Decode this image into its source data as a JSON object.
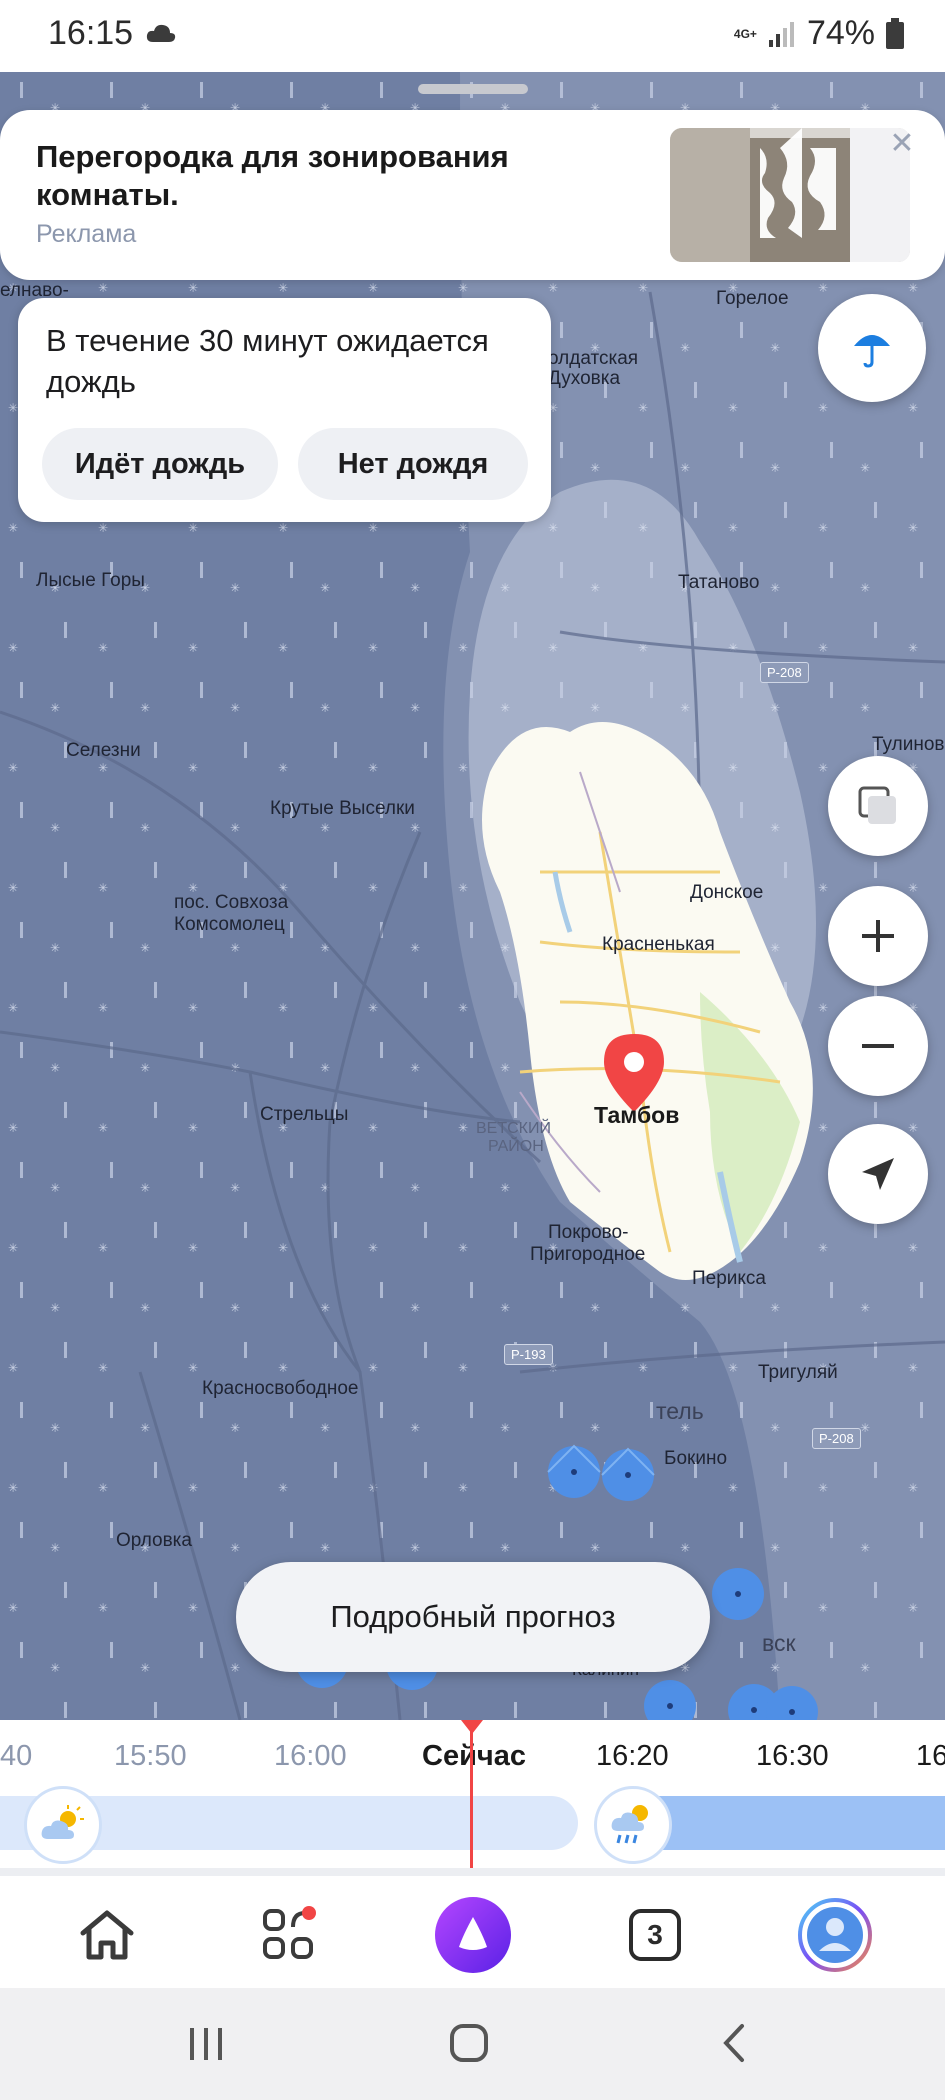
{
  "status_bar": {
    "time": "16:15",
    "weather_icon": "cloud-icon",
    "network": "4G+",
    "battery": "74%"
  },
  "ad": {
    "title": "Перегородка для зонирования комнаты.",
    "label": "Реклама",
    "close_icon": "close-icon"
  },
  "rain_card": {
    "message": "В течение 30 минут ожидается дождь",
    "option_yes": "Идёт дождь",
    "option_no": "Нет дождя"
  },
  "map": {
    "places": {
      "gorelove": "Горелое",
      "soldatskaya_1": "олдатская",
      "soldatskaya_2": "Духовка",
      "lysye_gory": "Лысые Горы",
      "tatanovo": "Татаново",
      "seleznі": "Селезни",
      "krutye_vyselki": "Крутые Выселки",
      "tulinovo": "Тулинов",
      "sovkhoz_1": "пос. Совхоза",
      "sovkhoz_2": "Комсомолец",
      "donskoe": "Донское",
      "krasnenkaya": "Красненькая",
      "streltsy": "Стрельцы",
      "tambov": "Тамбов",
      "district_1": "ВЕТСКИЙ",
      "district_2": "РАЙОН",
      "pokrovo_1": "Покрово-",
      "pokrovo_2": "Пригородное",
      "periksa": "Перикса",
      "triguly": "Тригуляй",
      "krasnosvobodnoe": "Красносвободное",
      "bokino": "Бокино",
      "orlovka": "Орловка",
      "partial_tel": "тель",
      "partial_vsk": "вск",
      "partial_kalinin": "Калинин",
      "partial_elnavo": "елнаво-"
    },
    "road_badges": [
      "Р-208",
      "Р-193",
      "Р-208"
    ]
  },
  "controls": {
    "umbrella_icon": "umbrella-icon",
    "layers_icon": "layers-icon",
    "zoom_in_icon": "plus-icon",
    "zoom_out_icon": "minus-icon",
    "location_icon": "navigation-arrow-icon"
  },
  "detail_button": "Подробный прогноз",
  "timeline": {
    "labels": [
      "40",
      "15:50",
      "16:00",
      "Сейчас",
      "16:20",
      "16:30",
      "16"
    ]
  },
  "tabbar": {
    "tabs_badge": "3",
    "home_icon": "home-icon",
    "services_icon": "services-grid-icon",
    "alice_icon": "alice-icon",
    "tabs_icon": "tabs-counter-icon",
    "profile_icon": "profile-avatar-icon"
  },
  "colors": {
    "map_rain": "#6f7fa3",
    "map_clear": "#fbfaf2",
    "accent_blue": "#1c7ee0",
    "alice_purple": "#7b2ff7",
    "now_red": "#f14545"
  }
}
